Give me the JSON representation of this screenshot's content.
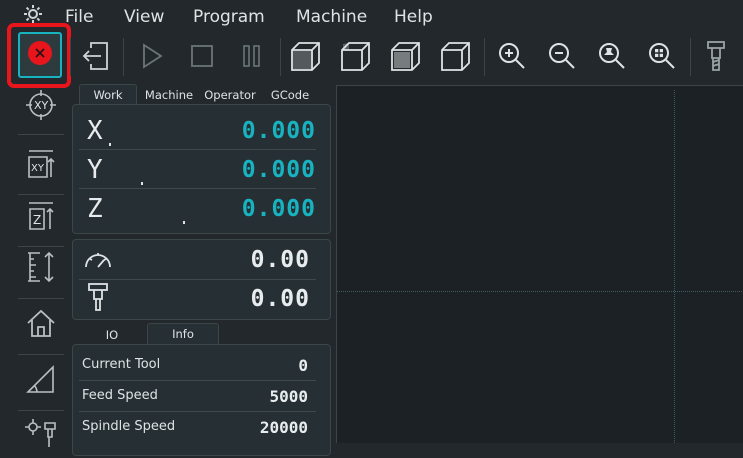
{
  "menubar": {
    "items": [
      "File",
      "View",
      "Program",
      "Machine",
      "Help"
    ],
    "app_icon": "gear-icon"
  },
  "toolbar": {
    "buttons": [
      "stop-icon",
      "exit-icon",
      "play-icon",
      "square-stop-icon",
      "pause-icon",
      "cube-iso-icon",
      "cube-front-icon",
      "cube-top-icon",
      "cube-side-icon",
      "zoom-in-icon",
      "zoom-out-icon",
      "zoom-fit-icon",
      "zoom-extents-icon",
      "tool-icon"
    ],
    "highlight_color": "#e8161c",
    "stop_color": "#e8161c",
    "accent_color": "#18b3c0"
  },
  "left_toolbar": {
    "buttons": [
      "zero-xy-icon",
      "probe-xy-icon",
      "probe-z-icon",
      "tool-length-icon",
      "home-icon",
      "angle-icon",
      "tool-change-icon"
    ]
  },
  "dro": {
    "tabs": [
      "Work",
      "Machine",
      "Operator",
      "GCode"
    ],
    "active_tab": "Work",
    "axes": [
      {
        "label": "X",
        "value": "0.000"
      },
      {
        "label": "Y",
        "value": "0.000"
      },
      {
        "label": "Z",
        "value": "0.000"
      }
    ]
  },
  "speeds": {
    "feed_value": "0.00",
    "spindle_value": "0.00"
  },
  "info": {
    "tabs": [
      "IO",
      "Info"
    ],
    "active_tab": "Info",
    "rows": [
      {
        "label": "Current Tool",
        "value": "0"
      },
      {
        "label": "Feed Speed",
        "value": "5000"
      },
      {
        "label": "Spindle Speed",
        "value": "20000"
      }
    ]
  }
}
